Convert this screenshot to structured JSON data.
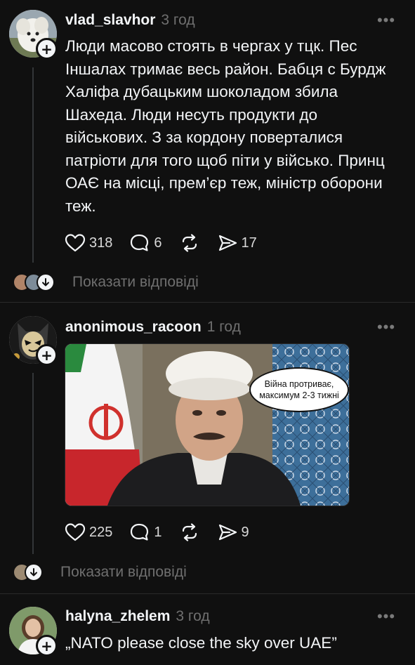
{
  "posts": [
    {
      "username": "vlad_slavhor",
      "time": "3 год",
      "text": "Люди масово стоять в чергах у тцк. Пес\nІншалах тримає весь район. Бабця с Бурдж\nХаліфа дубацьким шоколадом збила\nШахеда. Люди несуть продукти до\nвійськових. З за кордону поверталися\nпатріоти для того щоб піти у військо. Принц\nОАЄ на місці, прем’єр теж, міністр оборони\nтеж.",
      "likes": "318",
      "comments": "6",
      "shares": "17",
      "show_replies": "Показати відповіді"
    },
    {
      "username": "anonimous_racoon",
      "time": "1 год",
      "meme_caption_line1": "Війна протриває,",
      "meme_caption_line2": "максимум 2-3 тижні",
      "likes": "225",
      "comments": "1",
      "shares": "9",
      "show_replies": "Показати відповіді"
    },
    {
      "username": "halyna_zhelem",
      "time": "3 год",
      "text": "„NATO please close the sky over UAE”"
    }
  ],
  "icons": {
    "more": "more-dots-icon",
    "like": "heart-icon",
    "comment": "comment-bubble-icon",
    "repost": "repost-icon",
    "share": "send-icon",
    "follow": "plus-icon",
    "expand": "arrow-down-icon"
  },
  "colors": {
    "background": "#101010",
    "text": "#f3f5f7",
    "muted": "#6f6f6f",
    "thread_line": "#333638"
  }
}
